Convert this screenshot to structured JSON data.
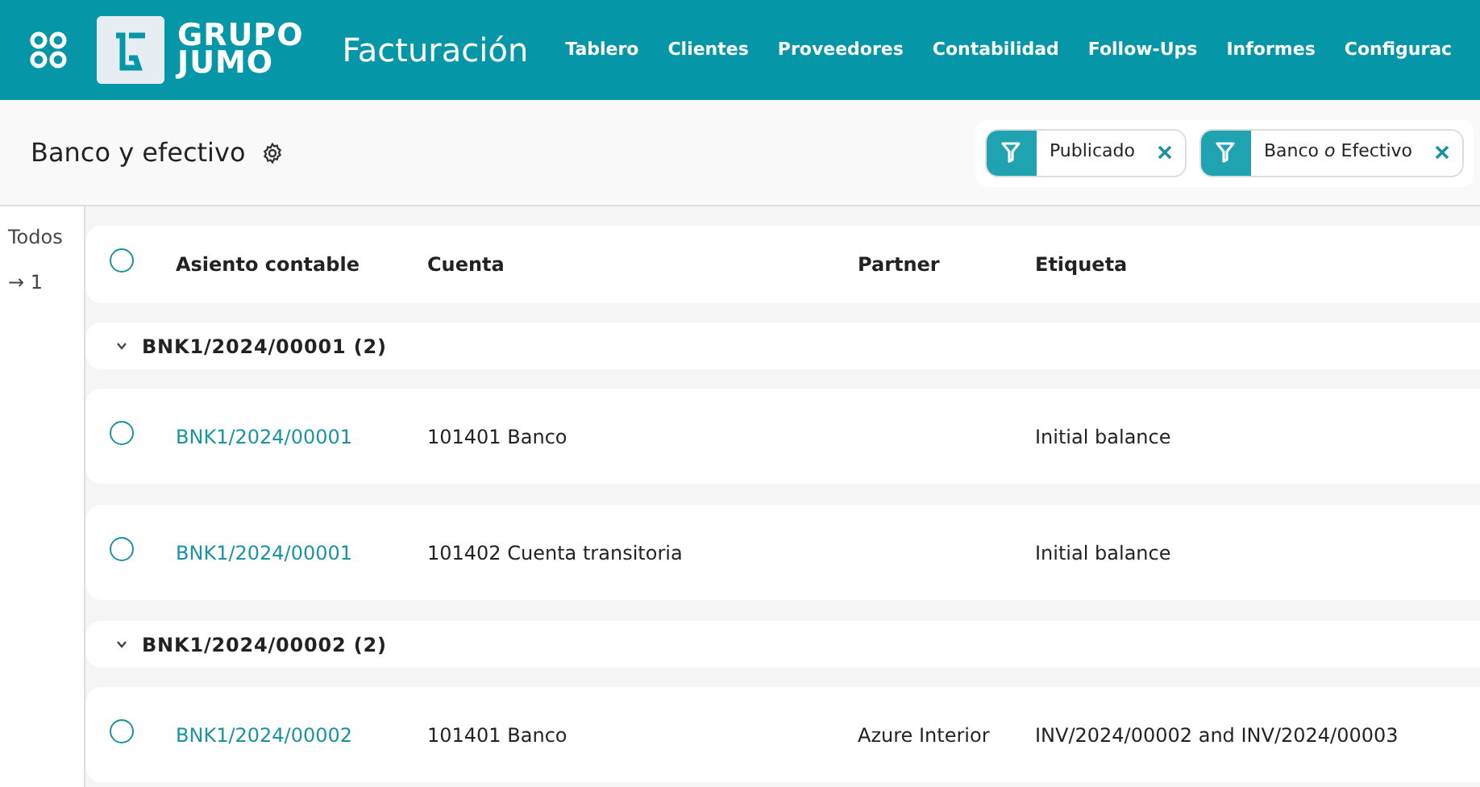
{
  "navbar": {
    "brand_line_1": "GRUPO",
    "brand_line_2": "JUMO",
    "app_title": "Facturación",
    "menu": [
      "Tablero",
      "Clientes",
      "Proveedores",
      "Contabilidad",
      "Follow-Ups",
      "Informes",
      "Configurac"
    ]
  },
  "control_panel": {
    "title": "Banco y efectivo",
    "facets": [
      {
        "label": "Publicado"
      },
      {
        "label": "Banco *o* Efectivo"
      }
    ]
  },
  "side_panel": {
    "items": [
      {
        "label": "Todos"
      },
      {
        "label": "→ 1"
      }
    ]
  },
  "table": {
    "header_checked": false,
    "columns": [
      "Asiento contable",
      "Cuenta",
      "Partner",
      "Etiqueta"
    ],
    "groups": [
      {
        "label": "BNK1/2024/00001 (2)",
        "expanded": true,
        "rows": [
          {
            "checked": false,
            "cells": [
              "BNK1/2024/00001",
              "101401 Banco",
              "",
              "Initial balance"
            ]
          },
          {
            "checked": false,
            "cells": [
              "BNK1/2024/00001",
              "101402 Cuenta transitoria",
              "",
              "Initial balance"
            ]
          }
        ]
      },
      {
        "label": "BNK1/2024/00002 (2)",
        "expanded": true,
        "rows": [
          {
            "checked": false,
            "cells": [
              "BNK1/2024/00002",
              "101401 Banco",
              "Azure Interior",
              "INV/2024/00002 and INV/2024/00003"
            ]
          }
        ]
      }
    ]
  }
}
